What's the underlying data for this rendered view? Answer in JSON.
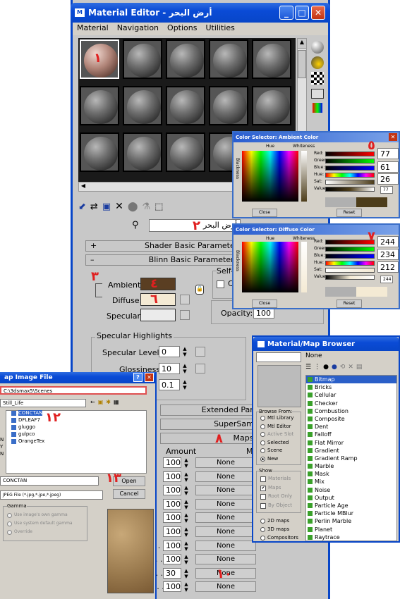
{
  "material_editor": {
    "title": "Material Editor - أرض البحر",
    "menu": [
      "Material",
      "Navigation",
      "Options",
      "Utilities"
    ],
    "slot_label": "١",
    "material_name": "أرض البحر",
    "name_marker": "٢",
    "rollouts": {
      "shader_basic": "Shader Basic Parameters",
      "blinn_basic": "Blinn Basic Parameters",
      "extended": "Extended Parameters",
      "supersampling": "SuperSampling",
      "maps": "Maps"
    },
    "blinn": {
      "ambient": "Ambient:",
      "diffuse": "Diffuse:",
      "specular": "Specular:",
      "self_illum": "Self-I",
      "opacity_label": "Opacity:",
      "opacity_value": "100",
      "lock_marker": "٣",
      "ambient_marker": "٤",
      "diffuse_marker": "٦"
    },
    "specular_highlights": {
      "group": "Specular Highlights",
      "level_label": "Specular Level:",
      "level_value": "0",
      "gloss_label": "Glossiness:",
      "gloss_value": "10",
      "soften_value": "0.1"
    },
    "maps": {
      "marker": "٨",
      "amount_header": "Amount",
      "map_header": "M",
      "rows": [
        {
          "label": "",
          "amount": "100",
          "map": "None",
          "checked": false
        },
        {
          "label": "",
          "amount": "100",
          "map": "None",
          "checked": false
        },
        {
          "label": "",
          "amount": "100",
          "map": "None",
          "checked": false
        },
        {
          "label": "",
          "amount": "100",
          "map": "None",
          "checked": false
        },
        {
          "label": "",
          "amount": "100",
          "map": "None",
          "checked": false
        },
        {
          "label": "",
          "amount": "100",
          "map": "None",
          "checked": false
        },
        {
          "label": "Opacity . . . . . . . .",
          "amount": "100",
          "map": "None",
          "checked": false
        },
        {
          "label": "Filter Color . . . . .",
          "amount": "100",
          "map": "None",
          "checked": false
        },
        {
          "label": "Bump . . . . . . . . .",
          "amount": "30",
          "map": "None",
          "checked": true
        },
        {
          "label": "Reflection . . . . . .",
          "amount": "100",
          "map": "None",
          "checked": false
        }
      ],
      "bump_marker": "٩",
      "bump_map_marker": "١٠"
    }
  },
  "ambient_selector": {
    "title": "Color Selector: Ambient Color",
    "marker": "٥",
    "hue": "Hue",
    "whiteness": "Whiteness",
    "blackness": "Blackness",
    "channels": [
      "Red:",
      "Green:",
      "Blue:",
      "Hue:",
      "Sat:",
      "Value:"
    ],
    "red": "77",
    "green": "61",
    "blue": "26",
    "value_small": "77",
    "close": "Close",
    "reset": "Reset",
    "swatch_color": "#4d3d1a"
  },
  "diffuse_selector": {
    "title": "Color Selector: Diffuse Color",
    "marker": "٧",
    "hue": "Hue",
    "whiteness": "Whiteness",
    "blackness": "Blackness",
    "channels": [
      "Red:",
      "Green:",
      "Blue:",
      "Hue:",
      "Sat:",
      "Value:"
    ],
    "red": "244",
    "green": "234",
    "blue": "212",
    "value_small": "244",
    "close": "Close",
    "reset": "Reset",
    "swatch_color": "#f4ead4"
  },
  "map_browser": {
    "title": "Material/Map Browser",
    "none_label": "None",
    "marker": "١١",
    "browse_from": "Browse From:",
    "browse_options": [
      "Mtl Library",
      "Mtl Editor",
      "Active Slot",
      "Selected",
      "Scene",
      "New"
    ],
    "show": "Show",
    "show_options": [
      "Materials",
      "Maps",
      "Root Only",
      "By Object"
    ],
    "type_options": [
      "2D maps",
      "3D maps",
      "Compositors"
    ],
    "items": [
      "Bitmap",
      "Bricks",
      "Cellular",
      "Checker",
      "Combustion",
      "Composite",
      "Dent",
      "Falloff",
      "Flat Mirror",
      "Gradient",
      "Gradient Ramp",
      "Marble",
      "Mask",
      "Mix",
      "Noise",
      "Output",
      "Particle Age",
      "Particle MBlur",
      "Perlin Marble",
      "Planet",
      "Raytrace"
    ]
  },
  "file_dialog": {
    "title": "ap Image File",
    "path": "C:\\3dsmax5\\Scenes",
    "look_in": "Still_Life",
    "files": [
      "CONCTAN",
      "DFLEAF7",
      "gluggo",
      "gulpco",
      "OrangeTex"
    ],
    "marker_files": "١٢",
    "filename": "CONCTAN",
    "filetype": "JPEG File (*.jpg,*.jpe,*.jpeg)",
    "open": "Open",
    "cancel": "Cancel",
    "marker_open": "١٣",
    "gamma": "Gamma",
    "gamma_options": [
      "Use image's own gamma",
      "Use system default gamma",
      "Override"
    ],
    "side_letters": [
      "N",
      "Y",
      "N"
    ]
  }
}
